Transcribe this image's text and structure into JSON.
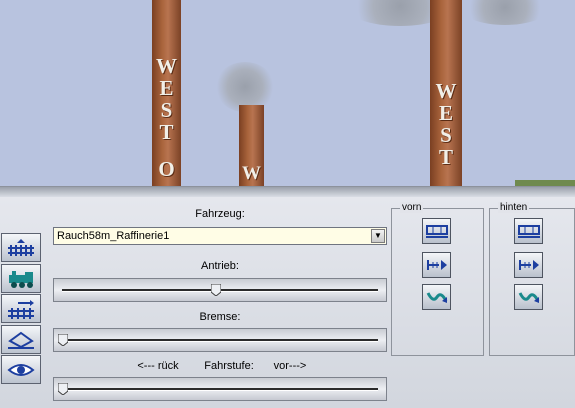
{
  "scene": {
    "chimneys": [
      {
        "letters": [
          "W",
          "E",
          "S",
          "T",
          "O"
        ]
      },
      {
        "letters": [
          "W"
        ]
      },
      {
        "letters": [
          "W",
          "E",
          "S",
          "T"
        ]
      }
    ]
  },
  "sidebar": {
    "buttons": [
      {
        "icon": "track-layout-icon"
      },
      {
        "icon": "locomotive-icon"
      },
      {
        "icon": "signal-track-icon"
      },
      {
        "icon": "terrain-icon"
      },
      {
        "icon": "eye-icon"
      }
    ]
  },
  "vehicle_panel": {
    "vehicle_label": "Fahrzeug:",
    "vehicle_value": "Rauch58m_Raffinerie1",
    "drive_label": "Antrieb:",
    "drive_level": 0.5,
    "brake_label": "Bremse:",
    "brake_level": 0.0,
    "reverse_label": "<--- rück",
    "speed_step_label": "Fahrstufe:",
    "forward_label": "vor--->",
    "speed_step_level": 0.0
  },
  "coupling": {
    "front_label": "vorn",
    "rear_label": "hinten",
    "tools": [
      "coupling-wagon-icon",
      "couple-arrow-icon",
      "uncouple-icon"
    ]
  },
  "colors": {
    "sky": "#b8c3df",
    "chimney": "#a9643c",
    "combo_bg": "#fffde6",
    "icon_blue": "#1d3fa0",
    "icon_teal": "#1a8a8c"
  }
}
